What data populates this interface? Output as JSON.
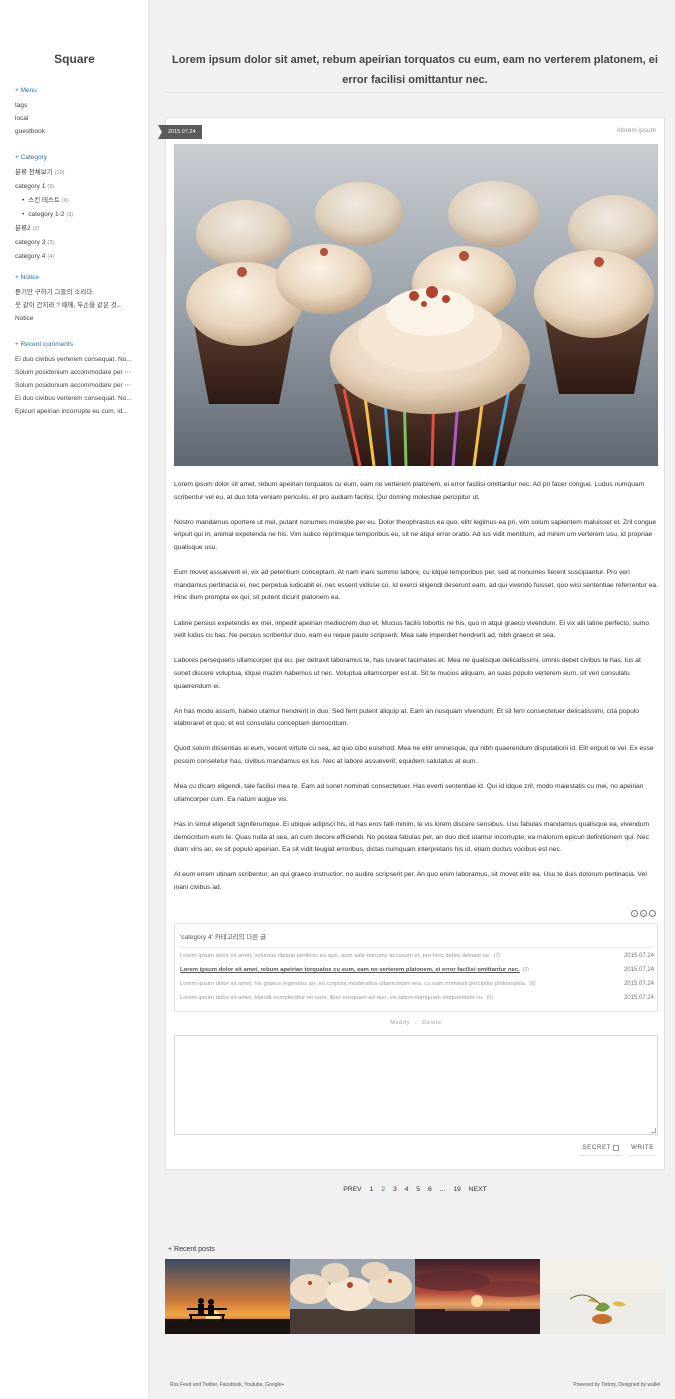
{
  "site": {
    "title": "Square"
  },
  "sidebar": {
    "menu": {
      "heading": "+ Menu",
      "items": [
        "tags",
        "local",
        "guestbook"
      ]
    },
    "category": {
      "heading": "+ Category",
      "items": [
        {
          "label": "분류 전체보기",
          "count": "(19)"
        },
        {
          "label": "category 1",
          "count": "(9)"
        },
        {
          "label": "스킨 테스트",
          "count": "(6)"
        },
        {
          "label": "category 1-2",
          "count": "(3)"
        },
        {
          "label": "분류2",
          "count": "(2)"
        },
        {
          "label": "category 3",
          "count": "(3)"
        },
        {
          "label": "category 4",
          "count": "(4)"
        }
      ]
    },
    "notice": {
      "heading": "+ Notice",
      "items": [
        "듣기만 구하기 그들의 소리다.",
        "웃 같이 간지라 ? 때에, 두손을 같은 것...",
        "Notice"
      ]
    },
    "comments": {
      "heading": "+ Recent comments",
      "items": [
        "Ei duo civibus verterem consequat. No...",
        "Solum posidonium accommodare per ⋯",
        "Solum posidonium accommodare per ⋯",
        "Ei duo civibus verterem consequat. No...",
        "Epicuri apeirian incorrupte eu cum, id..."
      ]
    }
  },
  "post": {
    "title": "Lorem ipsum dolor sit amet, rebum apeirian torquatos cu eum, eam no verterem platonem, ei error facilisi omittantur nec.",
    "date": "2015.07.24",
    "tag": "#lorem ipsum",
    "paragraphs": [
      "Lorem ipsum dolor sit amet, rebum apeirian torquatos cu eum, eam no verterem platonem, ei error facilisi omittantur nec. Ad pri facer congue. Ludus numquam scribentur vel eu, at duo tota veniam periculis, et pro audiam facilisi. Qui doming molestiae percipitur ut.",
      "Nostro mandamus oportere ut mel, putant nonumes molestie per eu. Dolor theophrastus ea quo, elitr legimus ea pri, vim solum sapientem maluisset et. Zril congue eripuit qui in, animal expetenda ne his. Vim iudico reprimique temporibus eu, sit ne atqui error oratio. Ad ius vidit mentitum, ad minim um verterem usu, id propriae qualisque usu.",
      "Eum movet assueverit ei, vix ad petentium conceptam. At nam inani summo labore, cu idque temporibus per, sed at nonumes fierent suscipiantur. Pro veri mandamus pertinacia ei, nec perpetua iudicabit ei, nec essent vidisse cu. Id exerci eligendi deserunt eam, ad qui vivendo fuisset, quo wisi sententiae referrentur ea. Hinc illum prompta ex qui, sit putent dicunt platonem ea.",
      "Latine persius expetendis ex mei, impedit apeirian mediocrem duo et. Mucius facilis lobortis ne his, quo in atqui graeco vivendum. Ei vix alii latine perfecto, sumo velit ludus cu has. Ne persius scribentur duo, eam eu reque paulo scripserit. Mea sale imperdiet hendrerit ad, nibh graeco et sea.",
      "Labores persequeris ullamcorper qui eu, per detraxit laboramus te, has iuvaret tacimates et. Mea ne qualisque delicatissimi, omnis debet civibus te has. Ius at sonet discere voluptua, idque mazim habemus ut nec. Voluptua ullamcorper est at. Sit te mucius aliquam, an suas populo verterem eum, sit veri consulatu quaerendum ei.",
      "An has modo assum, habeo utamur hendrerit in duo. Sed ferri putent aliquip at. Eam an nusquam vivendum. Et sit ferri consectetuer delicatissimi, cita populo elaboraret et quo, et est consulatu conceptam democritum.",
      "Quod solum dissentias ei eum, vocent virtute cu sea, ad quo cibo euismod. Mea ne elitr omnesque, qui nibh quaerendum disputationi id. Elit eripuit te vel. Ex esse possim consetetur has, civibus mandamus ex ius. Nec at labore assueverit, equidem salutatus at eum.",
      "Mea cu dicam eligendi, tale facilisi mea te. Eam ad sonet nominati consectetuer. Has everti sententiae id. Qui id idque zril, modo maiestatis cu mei, no apeirian ullamcorper cum. Ea natum augue vis.",
      "Has in simul eligendi signiferumque. Ei ubique adipisci his, id has eros falli minim, te vis lorem discere sensibus. Usu fabulas mandamus qualisque ea, vivendum democritum eum te. Quas nulla at sea, an cum decore efficiendi. No postea fabulas per, an duo dicit utamur incorrupte, ea malorum epicuri definitionem qui. Nec diam viris an, ex sit populo apeirian. Ea sit vidit feugiat erroribus, dictas numquam interpretaris his id, etiam doctus vocibus est nec.",
      "At eum errem utinam scribentur, an qui graeco instructior, no audire scripserit per. An quo enim laboramus, sit movet elitr ea. Usu te duis dolorum pertinacia. Vel inani civibus ad."
    ],
    "share_icons": [
      "info-icon",
      "copyright-icon",
      "minus-icon"
    ]
  },
  "related": {
    "heading": "'category 4' 카테고리의 다른 글",
    "rows": [
      {
        "title": "Lorem ipsum dolor sit amet, volumus tibique perfecto eu quo, eum sale nonumy accusam et, pro hinc debet detraxit ne.",
        "count": "(7)",
        "date": "2015.07.24",
        "current": false
      },
      {
        "title": "Lorem ipsum dolor sit amet, rebum apeirian torquatos cu eum, eam no verterem platonem, ei error facilisi omittantur nec.",
        "count": "(0)",
        "date": "2015.07.24",
        "current": true
      },
      {
        "title": "Lorem ipsum dolor sit amet, his graece legendos an, eu corpora moderatius ullamcorper sea, cu nam nominati percipitur philosophia.",
        "count": "(0)",
        "date": "2015.07.24",
        "current": false
      },
      {
        "title": "Lorem ipsum dolor sit amet, blandit complectitur no nam, liber nusquam ad duo, vis tation numquam eloquentiam cu.",
        "count": "(0)",
        "date": "2015.07.24",
        "current": false
      }
    ]
  },
  "admin": {
    "modify": "Modify",
    "sep": "/",
    "delete": "Delete"
  },
  "comment_form": {
    "secret_label": "SECRET",
    "write_label": "WRITE"
  },
  "pager": {
    "prev": "PREV",
    "pages": [
      "1",
      "2",
      "3",
      "4",
      "5",
      "6",
      "...",
      "19"
    ],
    "current": "2",
    "next": "NEXT"
  },
  "recent_posts": {
    "heading": "+ Recent posts"
  },
  "footer": {
    "left": "Rss Feed and Twitter, Facebook, Youtube, Google+",
    "right": "Powered by Tistory, Designed by wallel"
  },
  "colors": {
    "accent": "#2a6fa8",
    "date_tag": "#5a5a5a",
    "background": "#f1f1f1"
  }
}
